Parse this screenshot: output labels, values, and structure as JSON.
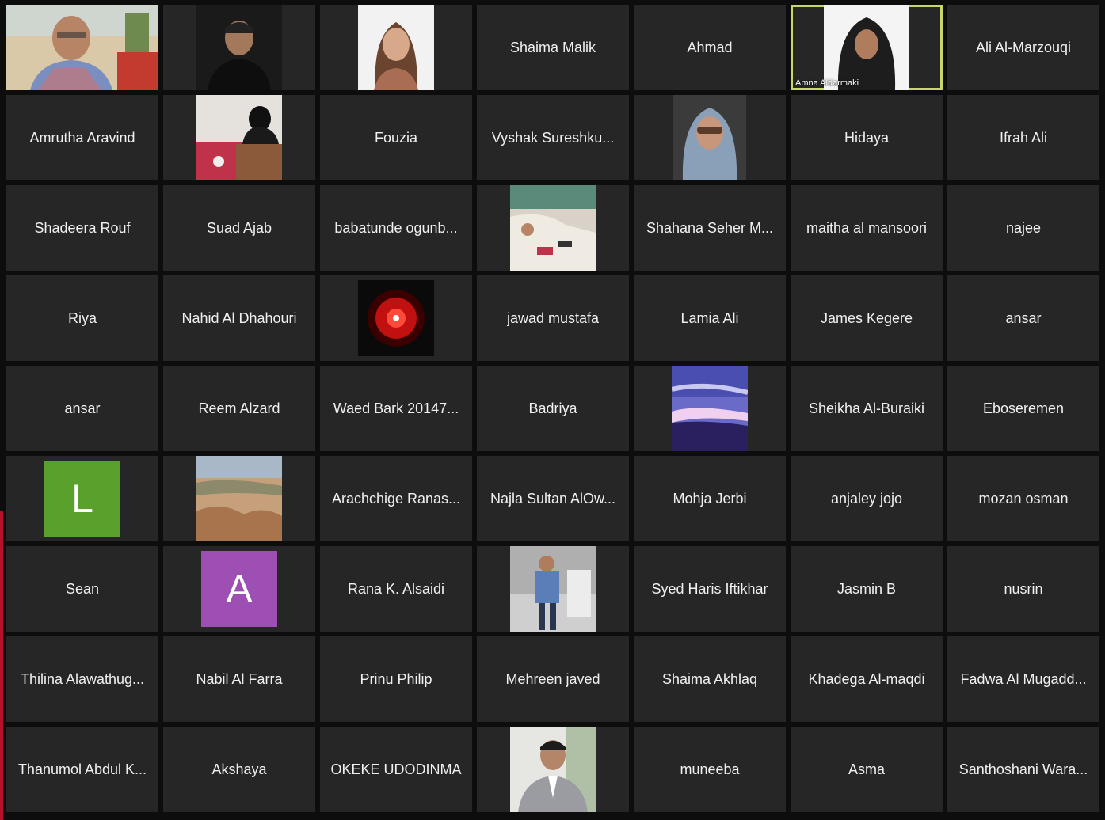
{
  "colors": {
    "background": "#0d0d0d",
    "tile": "#262626",
    "tile_text": "#f0f0f0",
    "active_speaker_border": "#c9d66b",
    "accent_red": "#b3122a"
  },
  "participants": [
    {
      "kind": "photo",
      "photo": "man-glasses-office"
    },
    {
      "kind": "photo",
      "photo": "man-black-tshirt"
    },
    {
      "kind": "photo",
      "photo": "woman-portrait"
    },
    {
      "kind": "name",
      "name": "Shaima Malik"
    },
    {
      "kind": "name",
      "name": "Ahmad"
    },
    {
      "kind": "photo",
      "photo": "woman-hijab-portrait",
      "overlay": "Amna Aldarmaki",
      "active": true
    },
    {
      "kind": "name",
      "name": "Ali Al-Marzouqi"
    },
    {
      "kind": "name",
      "name": "Amrutha Aravind"
    },
    {
      "kind": "photo",
      "photo": "woman-at-podium"
    },
    {
      "kind": "name",
      "name": "Fouzia"
    },
    {
      "kind": "name",
      "name": "Vyshak Sureshku..."
    },
    {
      "kind": "photo",
      "photo": "woman-sunglasses-scarf"
    },
    {
      "kind": "name",
      "name": "Hidaya"
    },
    {
      "kind": "name",
      "name": "Ifrah Ali"
    },
    {
      "kind": "name",
      "name": "Shadeera Rouf"
    },
    {
      "kind": "name",
      "name": "Suad Ajab"
    },
    {
      "kind": "name",
      "name": "babatunde ogunb..."
    },
    {
      "kind": "photo",
      "photo": "meeting-table"
    },
    {
      "kind": "name",
      "name": "Shahana Seher M..."
    },
    {
      "kind": "name",
      "name": "maitha al mansoori"
    },
    {
      "kind": "name",
      "name": "najee"
    },
    {
      "kind": "name",
      "name": "Riya"
    },
    {
      "kind": "name",
      "name": "Nahid Al Dhahouri"
    },
    {
      "kind": "photo",
      "photo": "red-lens"
    },
    {
      "kind": "name",
      "name": "jawad mustafa"
    },
    {
      "kind": "name",
      "name": "Lamia Ali"
    },
    {
      "kind": "name",
      "name": "James Kegere"
    },
    {
      "kind": "name",
      "name": "ansar"
    },
    {
      "kind": "name",
      "name": "ansar"
    },
    {
      "kind": "name",
      "name": "Reem Alzard"
    },
    {
      "kind": "name",
      "name": "Waed Bark 20147..."
    },
    {
      "kind": "name",
      "name": "Badriya"
    },
    {
      "kind": "photo",
      "photo": "purple-sky"
    },
    {
      "kind": "name",
      "name": "Sheikha Al-Buraiki"
    },
    {
      "kind": "name",
      "name": "Eboseremen"
    },
    {
      "kind": "avatar",
      "letter": "L",
      "color": "#5aa02c"
    },
    {
      "kind": "photo",
      "photo": "desert-landscape"
    },
    {
      "kind": "name",
      "name": "Arachchige Ranas..."
    },
    {
      "kind": "name",
      "name": "Najla Sultan AlOw..."
    },
    {
      "kind": "name",
      "name": "Mohja Jerbi"
    },
    {
      "kind": "name",
      "name": "anjaley jojo"
    },
    {
      "kind": "name",
      "name": "mozan osman"
    },
    {
      "kind": "name",
      "name": "Sean"
    },
    {
      "kind": "avatar",
      "letter": "A",
      "color": "#9d4fb3"
    },
    {
      "kind": "name",
      "name": "Rana K. Alsaidi"
    },
    {
      "kind": "photo",
      "photo": "man-blue-jacket-standing"
    },
    {
      "kind": "name",
      "name": "Syed Haris Iftikhar"
    },
    {
      "kind": "name",
      "name": "Jasmin B"
    },
    {
      "kind": "name",
      "name": "nusrin"
    },
    {
      "kind": "name",
      "name": "Thilina Alawathug..."
    },
    {
      "kind": "name",
      "name": "Nabil Al Farra"
    },
    {
      "kind": "name",
      "name": "Prinu Philip"
    },
    {
      "kind": "name",
      "name": "Mehreen javed"
    },
    {
      "kind": "name",
      "name": "Shaima Akhlaq"
    },
    {
      "kind": "name",
      "name": "Khadega Al-maqdi"
    },
    {
      "kind": "name",
      "name": "Fadwa Al Mugadd..."
    },
    {
      "kind": "name",
      "name": "Thanumol Abdul K..."
    },
    {
      "kind": "name",
      "name": "Akshaya"
    },
    {
      "kind": "name",
      "name": "OKEKE UDODINMA"
    },
    {
      "kind": "photo",
      "photo": "man-grey-suit"
    },
    {
      "kind": "name",
      "name": "muneeba"
    },
    {
      "kind": "name",
      "name": "Asma"
    },
    {
      "kind": "name",
      "name": "Santhoshani Wara..."
    }
  ]
}
